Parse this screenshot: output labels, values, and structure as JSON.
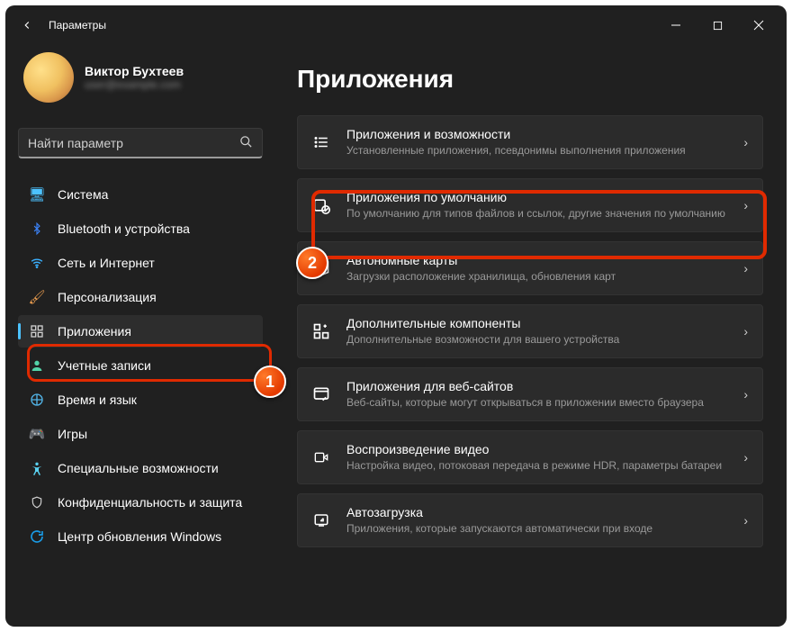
{
  "titlebar": {
    "title": "Параметры"
  },
  "user": {
    "name": "Виктор Бухтеев",
    "email": "user@example.com"
  },
  "search": {
    "placeholder": "Найти параметр"
  },
  "nav": {
    "system": "Система",
    "bluetooth": "Bluetooth и устройства",
    "network": "Сеть и Интернет",
    "personalization": "Персонализация",
    "apps": "Приложения",
    "accounts": "Учетные записи",
    "time": "Время и язык",
    "gaming": "Игры",
    "accessibility": "Специальные возможности",
    "privacy": "Конфиденциальность и защита",
    "update": "Центр обновления Windows"
  },
  "main": {
    "heading": "Приложения",
    "cards": {
      "appsFeatures": {
        "title": "Приложения и возможности",
        "sub": "Установленные приложения, псевдонимы выполнения приложения"
      },
      "defaultApps": {
        "title": "Приложения по умолчанию",
        "sub": "По умолчанию для типов файлов и ссылок, другие значения по умолчанию"
      },
      "offlineMaps": {
        "title": "Автономные карты",
        "sub": "Загрузки расположение хранилища, обновления карт"
      },
      "optional": {
        "title": "Дополнительные компоненты",
        "sub": "Дополнительные возможности для вашего устройства"
      },
      "websites": {
        "title": "Приложения для веб-сайтов",
        "sub": "Веб-сайты, которые могут открываться в приложении вместо браузера"
      },
      "video": {
        "title": "Воспроизведение видео",
        "sub": "Настройка видео, потоковая передача в режиме HDR, параметры батареи"
      },
      "startup": {
        "title": "Автозагрузка",
        "sub": "Приложения, которые запускаются автоматически при входе"
      }
    }
  },
  "annotations": {
    "one": "1",
    "two": "2"
  }
}
